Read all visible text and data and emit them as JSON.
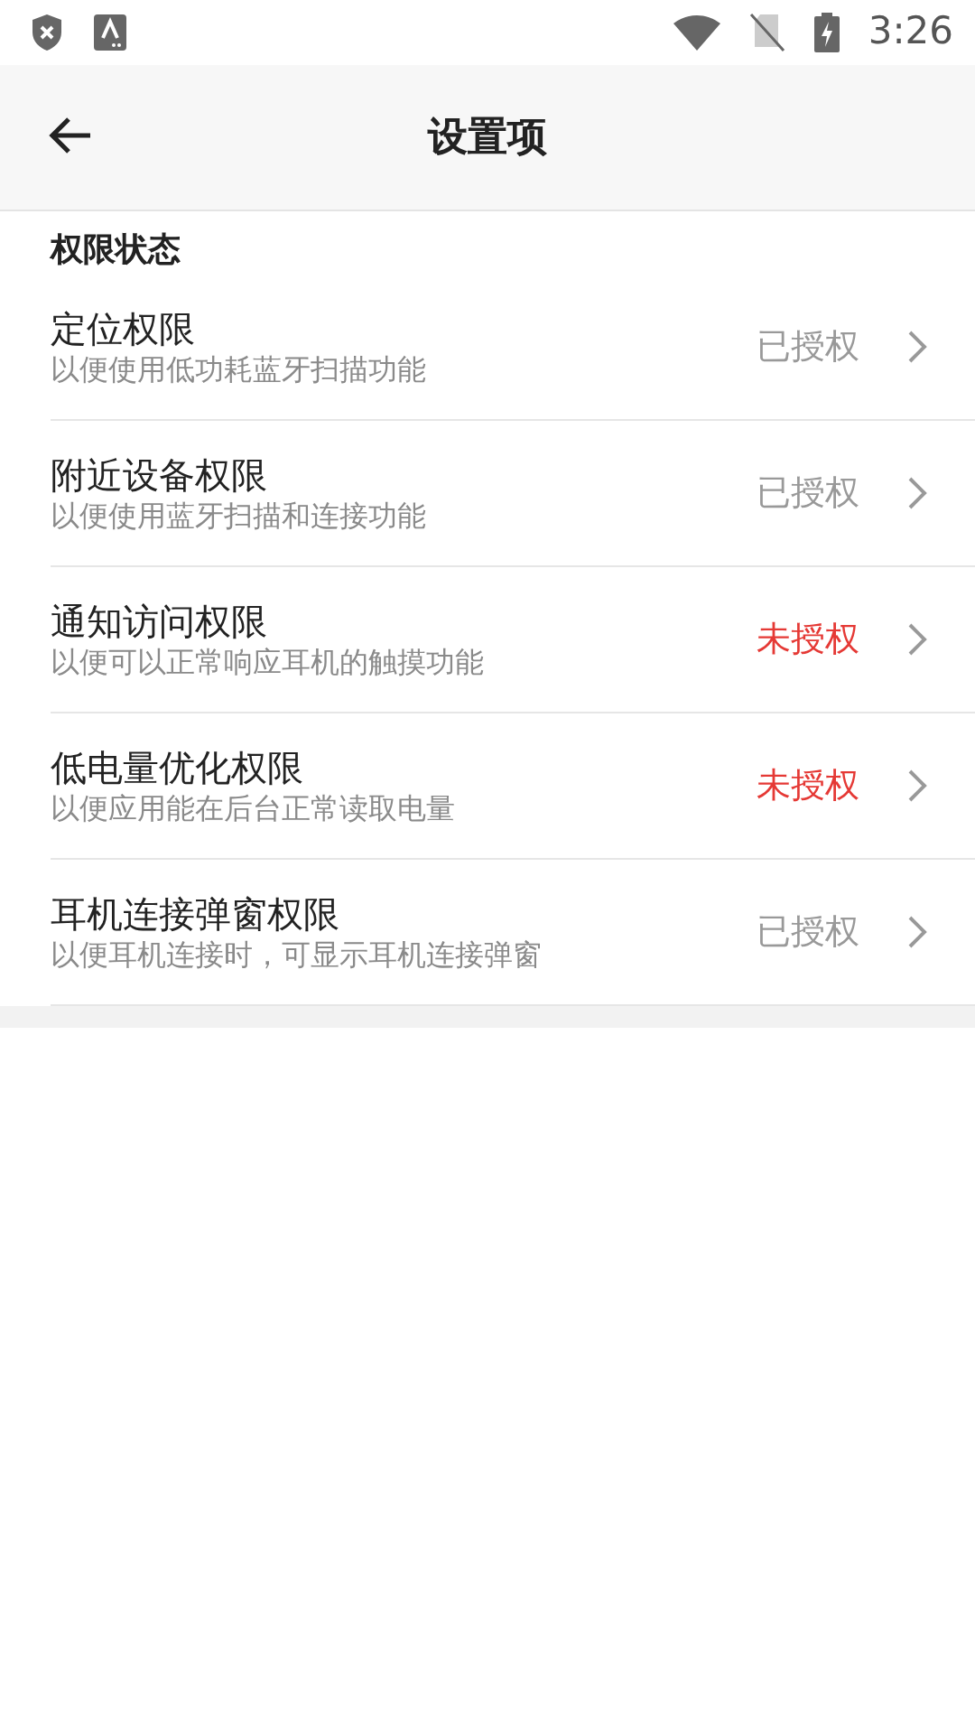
{
  "status_bar": {
    "time": "3:26"
  },
  "header": {
    "title": "设置项"
  },
  "section": {
    "title": "权限状态",
    "items": [
      {
        "title": "定位权限",
        "subtitle": "以便使用低功耗蓝牙扫描功能",
        "status": "已授权",
        "granted": true
      },
      {
        "title": "附近设备权限",
        "subtitle": "以便使用蓝牙扫描和连接功能",
        "status": "已授权",
        "granted": true
      },
      {
        "title": "通知访问权限",
        "subtitle": "以便可以正常响应耳机的触摸功能",
        "status": "未授权",
        "granted": false
      },
      {
        "title": "低电量优化权限",
        "subtitle": "以便应用能在后台正常读取电量",
        "status": "未授权",
        "granted": false
      },
      {
        "title": "耳机连接弹窗权限",
        "subtitle": "以便耳机连接时，可显示耳机连接弹窗",
        "status": "已授权",
        "granted": true
      }
    ]
  }
}
